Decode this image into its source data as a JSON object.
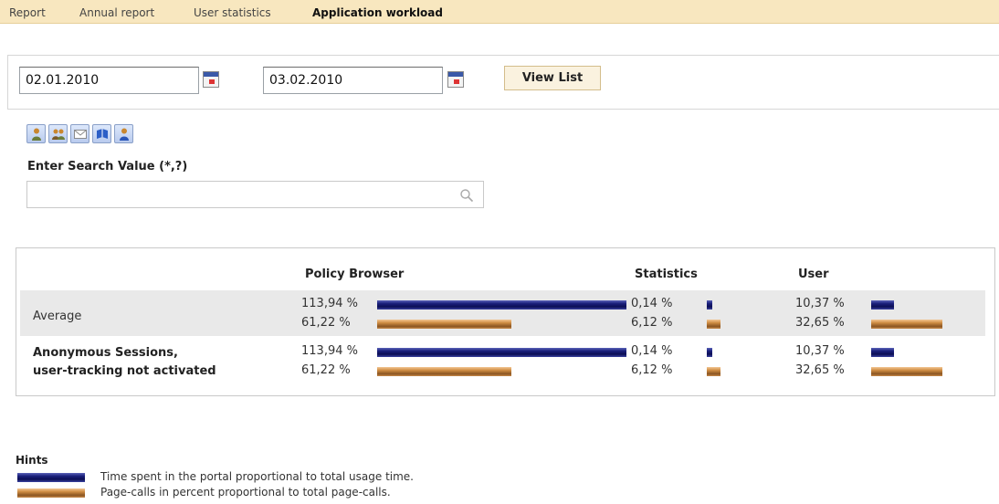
{
  "nav": {
    "tabs": [
      {
        "label": "Report",
        "active": false
      },
      {
        "label": "Annual report",
        "active": false
      },
      {
        "label": "User statistics",
        "active": false
      },
      {
        "label": "Application workload",
        "active": true
      }
    ]
  },
  "filter": {
    "date_from": "02.01.2010",
    "date_to": "03.02.2010",
    "view_button": "View List"
  },
  "toolbar_icons": [
    "user-icon",
    "users-group-icon",
    "envelope-icon",
    "book-icon",
    "person-icon"
  ],
  "search": {
    "label": "Enter Search Value (*,?)",
    "value": "",
    "placeholder": ""
  },
  "table": {
    "columns": [
      "Policy Browser",
      "Statistics",
      "User"
    ],
    "rows": [
      {
        "label": "Average",
        "cells": [
          {
            "time_pct": "113,94 %",
            "time_value": 113.94,
            "calls_pct": "61,22 %",
            "calls_value": 61.22
          },
          {
            "time_pct": "0,14 %",
            "time_value": 0.14,
            "calls_pct": "6,12 %",
            "calls_value": 6.12
          },
          {
            "time_pct": "10,37 %",
            "time_value": 10.37,
            "calls_pct": "32,65 %",
            "calls_value": 32.65
          }
        ]
      },
      {
        "label_line1": "Anonymous Sessions,",
        "label_line2": "user-tracking not activated",
        "cells": [
          {
            "time_pct": "113,94 %",
            "time_value": 113.94,
            "calls_pct": "61,22 %",
            "calls_value": 61.22
          },
          {
            "time_pct": "0,14 %",
            "time_value": 0.14,
            "calls_pct": "6,12 %",
            "calls_value": 6.12
          },
          {
            "time_pct": "10,37 %",
            "time_value": 10.37,
            "calls_pct": "32,65 %",
            "calls_value": 32.65
          }
        ]
      }
    ]
  },
  "hints": {
    "title": "Hints",
    "time": "Time spent in the portal proportional to total usage time.",
    "calls": "Page-calls in percent proportional to total page-calls."
  },
  "colors": {
    "nav_bg": "#f8e7bf",
    "time_bar": "#1a1f7a",
    "calls_bar": "#d08d43",
    "row_shade": "#e9e9e9"
  }
}
